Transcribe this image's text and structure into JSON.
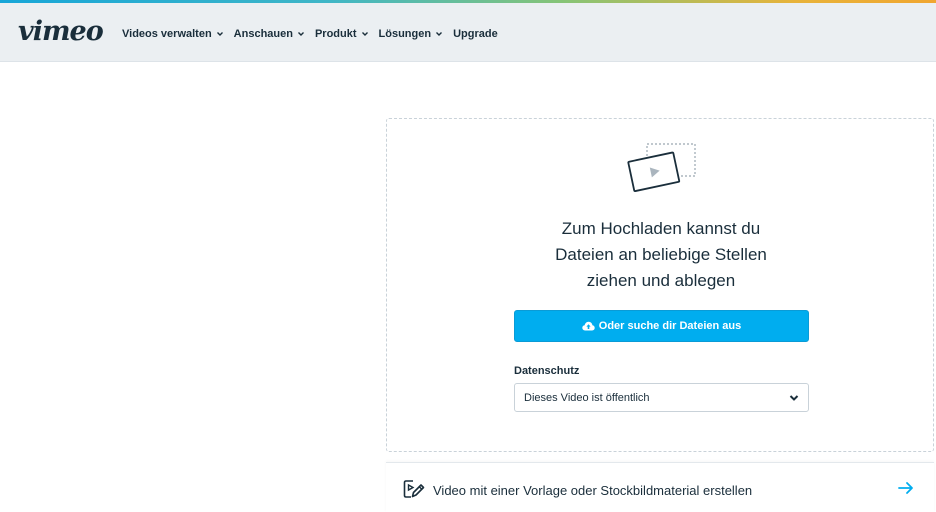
{
  "brand": {
    "logo_text": "vimeo",
    "accent_color": "#00adef"
  },
  "nav": {
    "items": [
      {
        "label": "Videos verwalten",
        "has_dropdown": true
      },
      {
        "label": "Anschauen",
        "has_dropdown": true
      },
      {
        "label": "Produkt",
        "has_dropdown": true
      },
      {
        "label": "Lösungen",
        "has_dropdown": true
      },
      {
        "label": "Upgrade",
        "has_dropdown": false
      }
    ]
  },
  "upload": {
    "drop_text_line1": "Zum Hochladen kannst du",
    "drop_text_line2": "Dateien an beliebige Stellen",
    "drop_text_line3": "ziehen und ablegen",
    "browse_button_label": "Oder suche dir Dateien aus",
    "privacy_label": "Datenschutz",
    "privacy_selected": "Dieses Video ist öffentlich"
  },
  "template": {
    "label": "Video mit einer Vorlage oder Stockbildmaterial erstellen"
  },
  "icons": {
    "upload_illustration": "video-frame-icon",
    "browse": "cloud-upload-icon",
    "template": "edit-video-icon",
    "arrow": "arrow-right-icon"
  }
}
